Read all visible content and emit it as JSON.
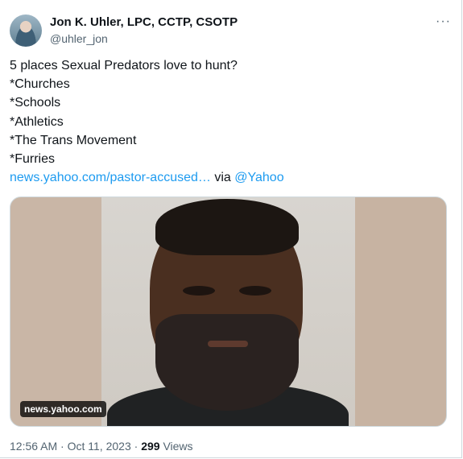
{
  "tweet": {
    "author": {
      "display_name": "Jon K. Uhler, LPC, CCTP, CSOTP",
      "handle": "@uhler_jon",
      "avatar_icon": "avatar-icon"
    },
    "more_icon": "ellipsis-icon",
    "lines": [
      "5 places Sexual Predators love to hunt?",
      "*Churches",
      "*Schools",
      "*Athletics",
      "*The Trans Movement",
      "*Furries"
    ],
    "link_text": "news.yahoo.com/pastor-accused…",
    "via_text": "via",
    "via_handle": "@Yahoo",
    "media": {
      "source_badge": "news.yahoo.com"
    },
    "meta": {
      "time": "12:56 AM",
      "separator": "·",
      "date": "Oct 11, 2023",
      "views_count": "299",
      "views_label": "Views"
    },
    "colors": {
      "link": "#1d9bf0",
      "text": "#0f1419",
      "secondary": "#536471",
      "border": "#cfd9de"
    }
  }
}
